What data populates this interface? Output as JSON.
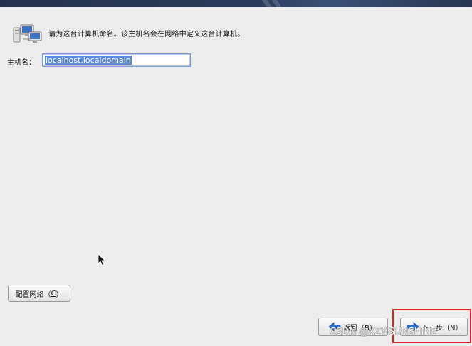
{
  "header": {
    "icon": "network-computers-icon",
    "text": "请为这台计算机命名。该主机名会在网络中定义这台计算机。"
  },
  "hostname": {
    "label": "主机名：",
    "value": "localhost.localdomain"
  },
  "buttons": {
    "configure_network": {
      "label_prefix": "配置网络（",
      "mnemonic": "C",
      "label_suffix": "）"
    },
    "back": {
      "label": "返回（B）",
      "icon": "arrow-left-icon"
    },
    "next": {
      "label": "下一步（N）",
      "icon": "arrow-right-icon"
    }
  },
  "watermark": "CSDN @XZY-SUNSHINE",
  "colors": {
    "banner": "#2d3c5e",
    "background": "#ececec",
    "selection": "#5c8ad6",
    "arrow_blue": "#2f6fc8",
    "highlight": "#e0242c"
  }
}
